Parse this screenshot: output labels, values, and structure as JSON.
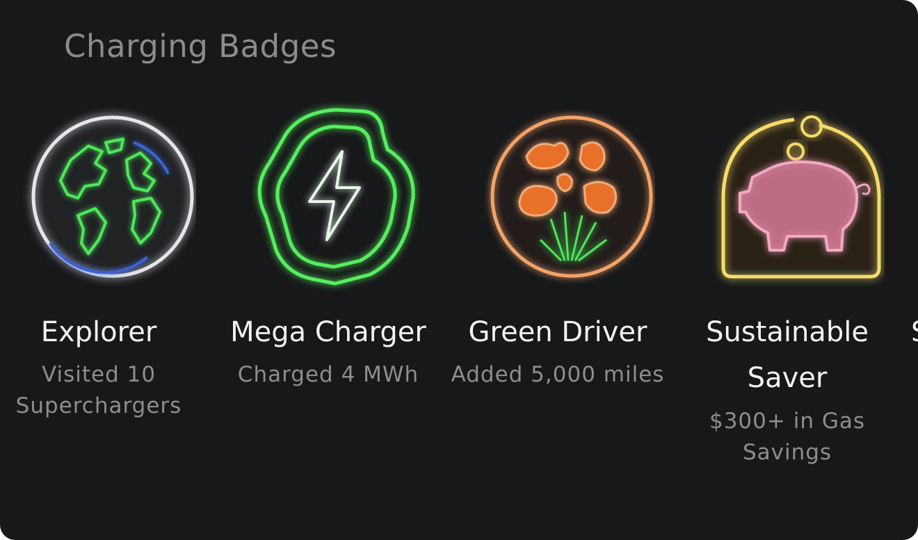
{
  "section": {
    "title": "Charging Badges"
  },
  "badges": [
    {
      "name": "Explorer",
      "description": "Visited 10 Superchargers",
      "icon": "globe-icon",
      "glow_color": "#3fd84a"
    },
    {
      "name": "Mega Charger",
      "description": "Charged 4 MWh",
      "icon": "lightning-bolt-icon",
      "glow_color": "#3fd84a"
    },
    {
      "name": "Green Driver",
      "description": "Added 5,000 miles",
      "icon": "poppy-flowers-icon",
      "glow_color": "#ff8a2a"
    },
    {
      "name": "Sustainable Saver",
      "description": "$300+ in Gas Savings",
      "icon": "piggy-bank-icon",
      "glow_color": "#f2d25a"
    }
  ],
  "partial_badge": {
    "name": "S"
  },
  "colors": {
    "background": "#17181a",
    "title": "#8b8c8e",
    "name": "#f2f2f2",
    "description": "#8d8e90"
  }
}
